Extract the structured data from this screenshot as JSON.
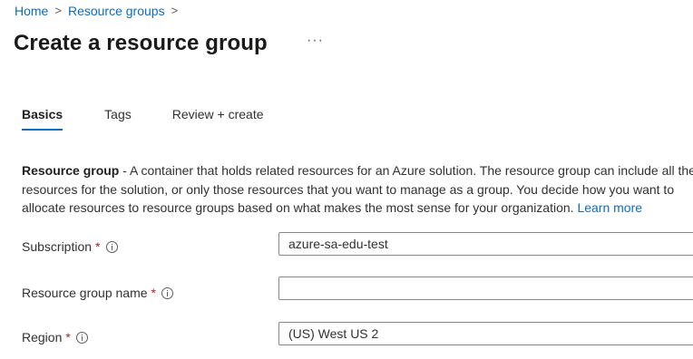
{
  "breadcrumb": {
    "items": [
      "Home",
      "Resource groups"
    ],
    "separator": ">"
  },
  "page": {
    "title": "Create a resource group",
    "more_label": "···"
  },
  "tabs": [
    {
      "label": "Basics",
      "active": true
    },
    {
      "label": "Tags",
      "active": false
    },
    {
      "label": "Review + create",
      "active": false
    }
  ],
  "description": {
    "term": "Resource group",
    "line1_rest": " - A container that holds related resources for an Azure solution. The resource group can include all the",
    "line2": "resources for the solution, or only those resources that you want to manage as a group. You decide how you want to",
    "line3": "allocate resources to resource groups based on what makes the most sense for your organization.",
    "link": "Learn more"
  },
  "form": {
    "subscription": {
      "label": "Subscription",
      "required_mark": "*",
      "value": "azure-sa-edu-test"
    },
    "resource_group_name": {
      "label": "Resource group name",
      "required_mark": "*",
      "value": "",
      "placeholder": ""
    },
    "region": {
      "label": "Region",
      "required_mark": "*",
      "value": "(US) West US 2"
    }
  },
  "colors": {
    "accent": "#0f6cbd",
    "required": "#a4262c",
    "text": "#323130",
    "border": "#8a8886"
  }
}
